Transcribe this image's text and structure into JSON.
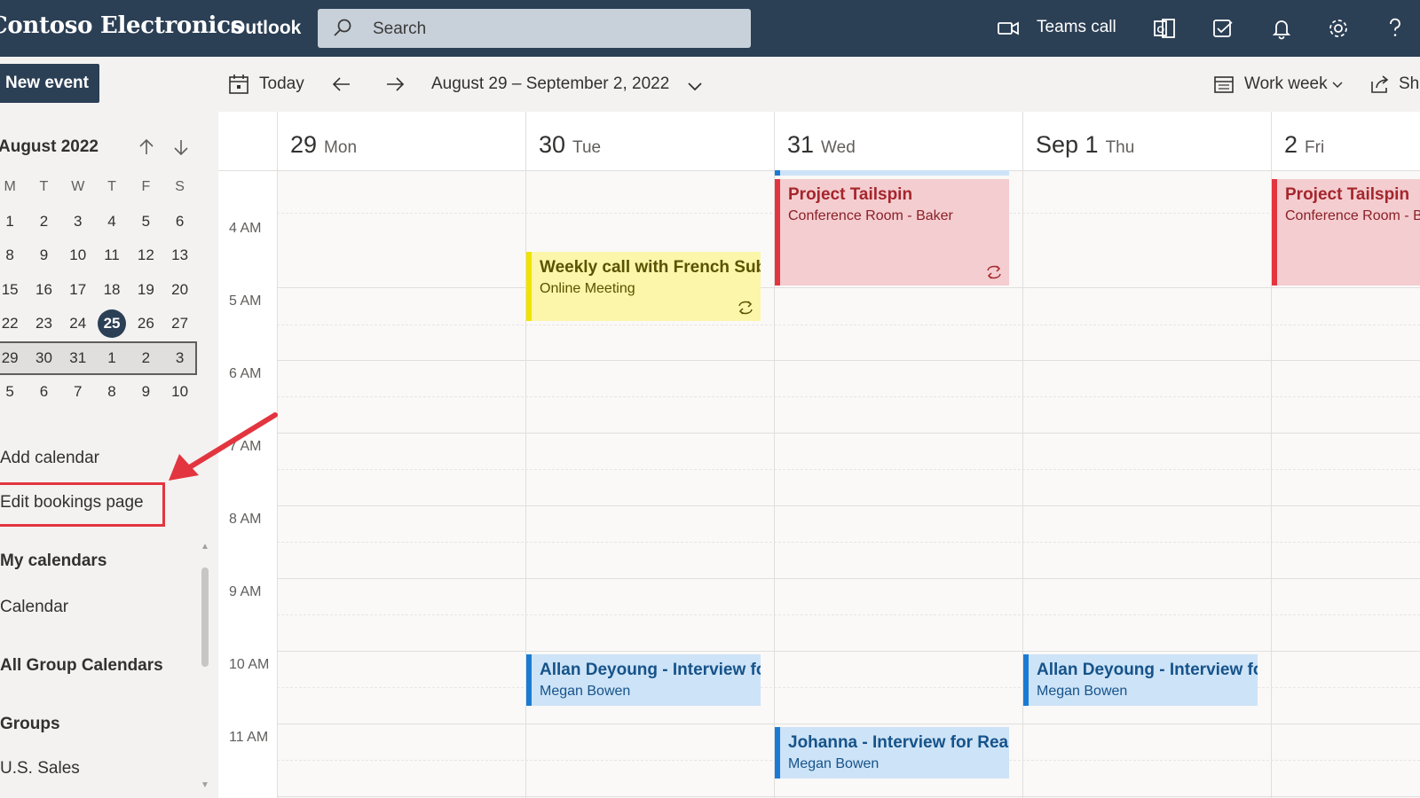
{
  "topbar": {
    "brand": "Contoso Electronics",
    "app_name": "Outlook",
    "search_placeholder": "Search",
    "teams_call_label": "Teams call"
  },
  "commandbar": {
    "new_event_label": "New event",
    "today_label": "Today",
    "date_range": "August 29 – September 2, 2022",
    "view_label": "Work week",
    "share_label": "Share"
  },
  "mini_calendar": {
    "month_title": "August 2022",
    "weekday_headers": [
      "M",
      "T",
      "W",
      "T",
      "F",
      "S"
    ],
    "weeks": [
      [
        "1",
        "2",
        "3",
        "4",
        "5",
        "6"
      ],
      [
        "8",
        "9",
        "10",
        "11",
        "12",
        "13"
      ],
      [
        "15",
        "16",
        "17",
        "18",
        "19",
        "20"
      ],
      [
        "22",
        "23",
        "24",
        "25",
        "26",
        "27"
      ],
      [
        "29",
        "30",
        "31",
        "1",
        "2",
        "3"
      ],
      [
        "5",
        "6",
        "7",
        "8",
        "9",
        "10"
      ]
    ],
    "today": "25"
  },
  "left_pane": {
    "add_calendar": "Add calendar",
    "edit_bookings_page": "Edit bookings page",
    "my_calendars_heading": "My calendars",
    "calendar_item": "Calendar",
    "all_group_calendars_heading": "All Group Calendars",
    "groups_heading": "Groups",
    "us_sales_item": "U.S. Sales"
  },
  "calendar": {
    "days": [
      {
        "num": "29",
        "name": "Mon"
      },
      {
        "num": "30",
        "name": "Tue"
      },
      {
        "num": "31",
        "name": "Wed"
      },
      {
        "num": "Sep 1",
        "name": "Thu"
      },
      {
        "num": "2",
        "name": "Fri"
      }
    ],
    "hours": [
      "4 AM",
      "5 AM",
      "6 AM",
      "7 AM",
      "8 AM",
      "9 AM",
      "10 AM",
      "11 AM"
    ],
    "events": {
      "tailspin_wed": {
        "title": "Project Tailspin",
        "subtitle": "Conference Room - Baker"
      },
      "tailspin_fri": {
        "title": "Project Tailspin",
        "subtitle": "Conference Room - Baker"
      },
      "weekly_call": {
        "title": "Weekly call with French Subsidiary",
        "subtitle": "Online Meeting"
      },
      "allan_tue": {
        "title": "Allan Deyoung - Interview for Role",
        "subtitle": "Megan Bowen"
      },
      "allan_thu": {
        "title": "Allan Deyoung - Interview for Role",
        "subtitle": "Megan Bowen"
      },
      "johanna_wed": {
        "title": "Johanna - Interview for React Developer",
        "subtitle": "Megan Bowen"
      }
    }
  },
  "colors": {
    "header_bg": "#2b3f55",
    "event_red": "#e3353f",
    "event_yellow": "#f0e300",
    "event_blue": "#1b7bd3",
    "annotation_red": "#e3353f"
  }
}
